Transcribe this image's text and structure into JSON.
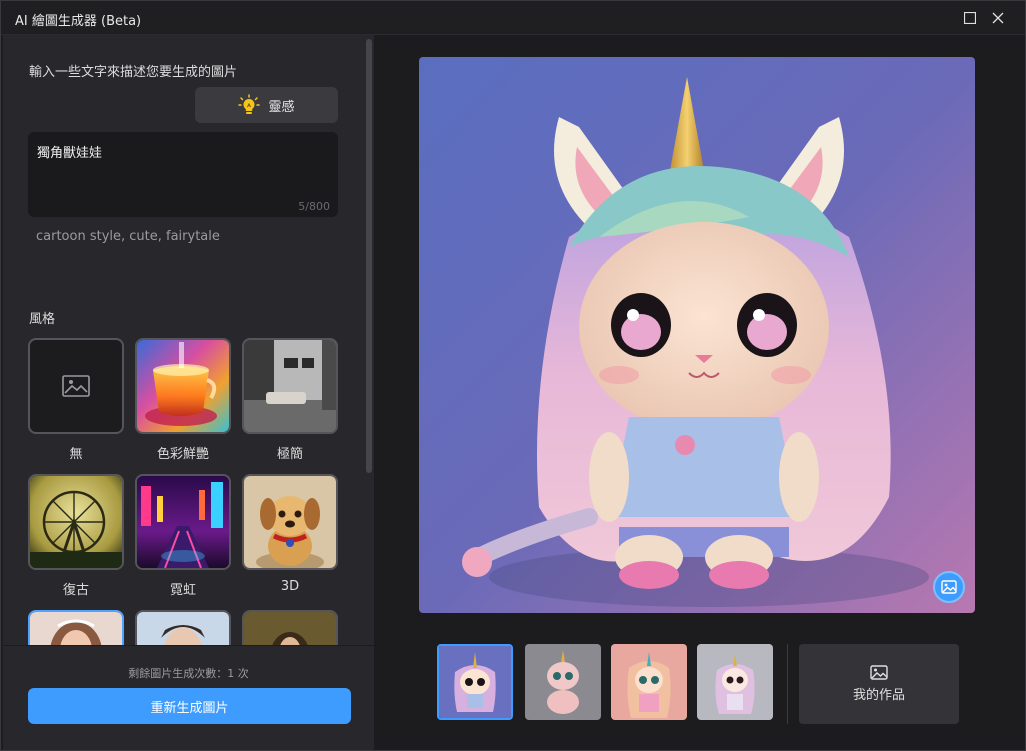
{
  "window": {
    "title": "AI 繪圖生成器 (Beta)"
  },
  "prompt": {
    "label": "輸入一些文字來描述您要生成的圖片",
    "inspire_label": "靈感",
    "text": "獨角獸娃娃",
    "count": "5/800",
    "tags": "cartoon style, cute, fairytale"
  },
  "styles": {
    "label": "風格",
    "items": [
      {
        "name": "無"
      },
      {
        "name": "色彩鮮艷"
      },
      {
        "name": "極簡"
      },
      {
        "name": "復古"
      },
      {
        "name": "霓虹"
      },
      {
        "name": "3D"
      }
    ]
  },
  "footer": {
    "remaining": "剩餘圖片生成次數：1 次",
    "regenerate_label": "重新生成圖片"
  },
  "gallery": {
    "my_works_label": "我的作品"
  },
  "colors": {
    "accent": "#3f9cff",
    "panel": "#28282c",
    "background": "#1c1c1f"
  }
}
